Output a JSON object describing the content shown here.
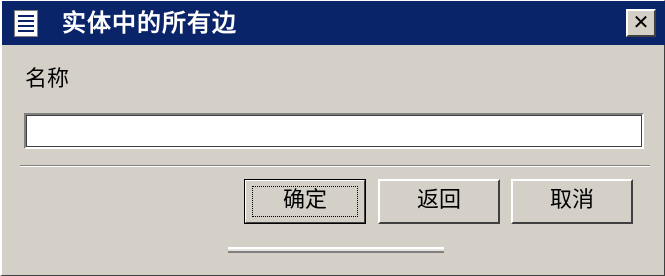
{
  "window": {
    "title": "实体中的所有边",
    "close_glyph": "✕",
    "icon": "window-icon"
  },
  "form": {
    "name_label": "名称",
    "name_value": "",
    "name_placeholder": ""
  },
  "buttons": {
    "ok_label": "确定",
    "back_label": "返回",
    "cancel_label": "取消"
  },
  "colors": {
    "titlebar": "#0a246a",
    "dialog_bg": "#d4d0c8",
    "input_bg": "#ffffff"
  }
}
